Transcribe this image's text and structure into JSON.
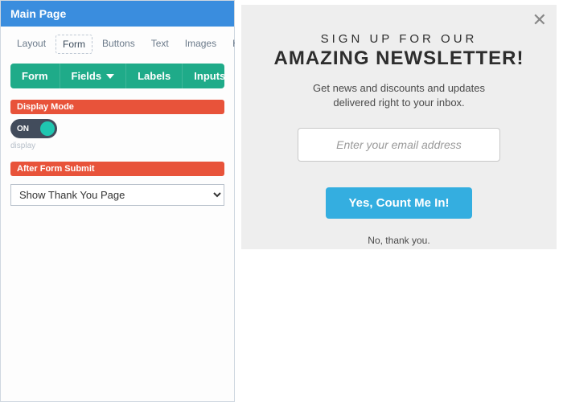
{
  "panel": {
    "title": "Main Page",
    "tabs": [
      "Layout",
      "Form",
      "Buttons",
      "Text",
      "Images",
      "HTML"
    ],
    "active_tab_index": 1,
    "form_subnav": {
      "form": "Form",
      "fields": "Fields",
      "labels": "Labels",
      "inputs": "Inputs"
    },
    "display_mode": {
      "label": "Display Mode",
      "toggle_state": "ON",
      "hint": "display"
    },
    "after_submit": {
      "label": "After Form Submit",
      "selected": "Show Thank You Page"
    }
  },
  "modal": {
    "eyebrow": "SIGN UP FOR OUR",
    "headline": "AMAZING NEWSLETTER!",
    "subtext_line1": "Get news and discounts and updates",
    "subtext_line2": "delivered right to your inbox.",
    "email_placeholder": "Enter your email address",
    "cta": "Yes, Count Me In!",
    "decline": "No, thank you."
  },
  "colors": {
    "header_blue": "#3a8dde",
    "green": "#1fab89",
    "orange": "#e8533a",
    "cta_blue": "#34aee0"
  }
}
